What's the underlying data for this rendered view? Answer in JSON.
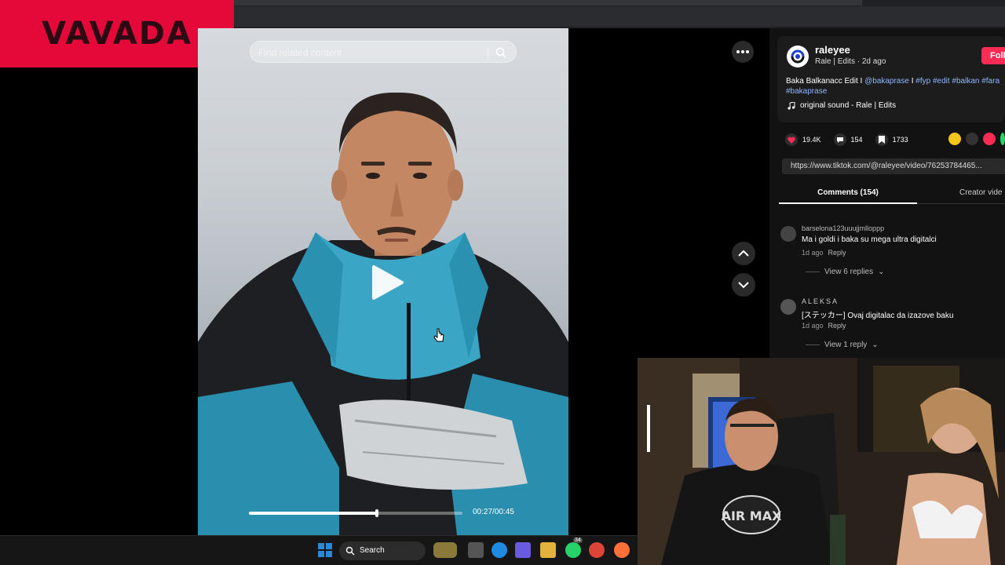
{
  "brand": {
    "logo_text": "VAVADA"
  },
  "video": {
    "search_placeholder": "Find related content",
    "time_current": "00:27",
    "time_total": "00:45",
    "progress_fraction": 0.6
  },
  "author": {
    "name": "raleyee",
    "subtitle": "Rale | Edits · 2d ago",
    "follow_label": "Follow"
  },
  "description": {
    "text_prefix": "Baka Balkanacc Edit I ",
    "mention": "@bakaprase",
    "separator": " I ",
    "tags": "#fyp #edit #balkan #fara",
    "tags_line2": "#bakaprase"
  },
  "sound": {
    "label": "original sound - Rale | Edits"
  },
  "stats": {
    "likes": "19.4K",
    "comments": "154",
    "saves": "1733"
  },
  "link": {
    "url": "https://www.tiktok.com/@raleyee/video/76253784465..."
  },
  "tabs": {
    "comments": "Comments (154)",
    "creator": "Creator vide"
  },
  "comments": [
    {
      "user": "barselona123uuujjmlloppp",
      "text": "Ma i goldi i baka su mega ultra digitalci",
      "age": "1d ago",
      "reply": "Reply",
      "replies": "View 6 replies"
    },
    {
      "user": "ALEKSA",
      "text": "[ステッカー] Ovaj digitalac da izazove baku",
      "age": "1d ago",
      "reply": "Reply",
      "replies": "View 1 reply"
    }
  ],
  "webcam": {
    "shirt_text": "AIR MAX"
  },
  "taskbar": {
    "search_label": "Search",
    "whatsapp_badge": "34"
  },
  "colors": {
    "brand": "#e5093a",
    "follow": "#fe2c55",
    "tag": "#8fb7ff",
    "like": "#fe2c55"
  }
}
